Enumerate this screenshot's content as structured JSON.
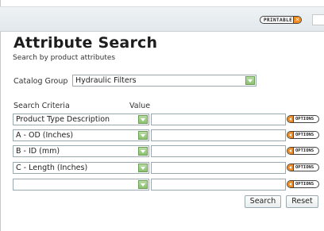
{
  "toolbar": {
    "printable_label": "PRINTABLE",
    "printable_icon": "close-x-icon"
  },
  "page": {
    "title": "Attribute Search",
    "subtitle": "Search by product attributes"
  },
  "catalog_group": {
    "label": "Catalog Group",
    "selected": "Hydraulic Filters"
  },
  "criteria": {
    "header": "Search Criteria",
    "value_header": "Value",
    "option_label": "OPTIONS",
    "rows": [
      {
        "criterion": "Product Type Description",
        "value": ""
      },
      {
        "criterion": "A - OD (Inches)",
        "value": ""
      },
      {
        "criterion": "B - ID (mm)",
        "value": ""
      },
      {
        "criterion": "C - Length (Inches)",
        "value": ""
      },
      {
        "criterion": "",
        "value": ""
      }
    ]
  },
  "actions": {
    "search_label": "Search",
    "reset_label": "Reset"
  },
  "colors": {
    "accent": "#f08a1c",
    "dropdown": "#8cc270",
    "border": "#9aa8b0"
  }
}
